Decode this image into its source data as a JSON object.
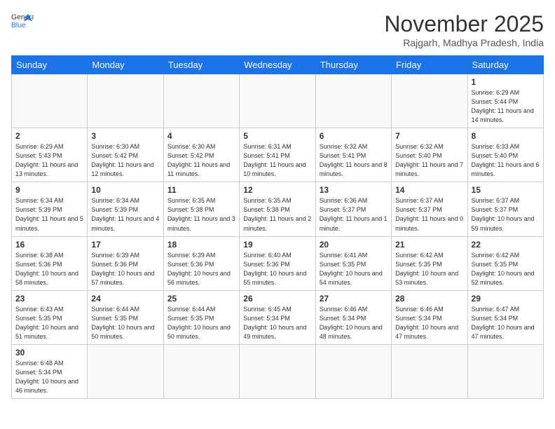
{
  "header": {
    "logo_general": "General",
    "logo_blue": "Blue",
    "month_title": "November 2025",
    "subtitle": "Rajgarh, Madhya Pradesh, India"
  },
  "weekdays": [
    "Sunday",
    "Monday",
    "Tuesday",
    "Wednesday",
    "Thursday",
    "Friday",
    "Saturday"
  ],
  "days": [
    {
      "date": "",
      "info": ""
    },
    {
      "date": "",
      "info": ""
    },
    {
      "date": "",
      "info": ""
    },
    {
      "date": "",
      "info": ""
    },
    {
      "date": "",
      "info": ""
    },
    {
      "date": "",
      "info": ""
    },
    {
      "date": "1",
      "info": "Sunrise: 6:29 AM\nSunset: 5:44 PM\nDaylight: 11 hours\nand 14 minutes."
    },
    {
      "date": "2",
      "info": "Sunrise: 6:29 AM\nSunset: 5:43 PM\nDaylight: 11 hours\nand 13 minutes."
    },
    {
      "date": "3",
      "info": "Sunrise: 6:30 AM\nSunset: 5:42 PM\nDaylight: 11 hours\nand 12 minutes."
    },
    {
      "date": "4",
      "info": "Sunrise: 6:30 AM\nSunset: 5:42 PM\nDaylight: 11 hours\nand 11 minutes."
    },
    {
      "date": "5",
      "info": "Sunrise: 6:31 AM\nSunset: 5:41 PM\nDaylight: 11 hours\nand 10 minutes."
    },
    {
      "date": "6",
      "info": "Sunrise: 6:32 AM\nSunset: 5:41 PM\nDaylight: 11 hours\nand 8 minutes."
    },
    {
      "date": "7",
      "info": "Sunrise: 6:32 AM\nSunset: 5:40 PM\nDaylight: 11 hours\nand 7 minutes."
    },
    {
      "date": "8",
      "info": "Sunrise: 6:33 AM\nSunset: 5:40 PM\nDaylight: 11 hours\nand 6 minutes."
    },
    {
      "date": "9",
      "info": "Sunrise: 6:34 AM\nSunset: 5:39 PM\nDaylight: 11 hours\nand 5 minutes."
    },
    {
      "date": "10",
      "info": "Sunrise: 6:34 AM\nSunset: 5:39 PM\nDaylight: 11 hours\nand 4 minutes."
    },
    {
      "date": "11",
      "info": "Sunrise: 6:35 AM\nSunset: 5:38 PM\nDaylight: 11 hours\nand 3 minutes."
    },
    {
      "date": "12",
      "info": "Sunrise: 6:35 AM\nSunset: 5:38 PM\nDaylight: 11 hours\nand 2 minutes."
    },
    {
      "date": "13",
      "info": "Sunrise: 6:36 AM\nSunset: 5:37 PM\nDaylight: 11 hours\nand 1 minute."
    },
    {
      "date": "14",
      "info": "Sunrise: 6:37 AM\nSunset: 5:37 PM\nDaylight: 11 hours\nand 0 minutes."
    },
    {
      "date": "15",
      "info": "Sunrise: 6:37 AM\nSunset: 5:37 PM\nDaylight: 10 hours\nand 59 minutes."
    },
    {
      "date": "16",
      "info": "Sunrise: 6:38 AM\nSunset: 5:36 PM\nDaylight: 10 hours\nand 58 minutes."
    },
    {
      "date": "17",
      "info": "Sunrise: 6:39 AM\nSunset: 5:36 PM\nDaylight: 10 hours\nand 57 minutes."
    },
    {
      "date": "18",
      "info": "Sunrise: 6:39 AM\nSunset: 5:36 PM\nDaylight: 10 hours\nand 56 minutes."
    },
    {
      "date": "19",
      "info": "Sunrise: 6:40 AM\nSunset: 5:36 PM\nDaylight: 10 hours\nand 55 minutes."
    },
    {
      "date": "20",
      "info": "Sunrise: 6:41 AM\nSunset: 5:35 PM\nDaylight: 10 hours\nand 54 minutes."
    },
    {
      "date": "21",
      "info": "Sunrise: 6:42 AM\nSunset: 5:35 PM\nDaylight: 10 hours\nand 53 minutes."
    },
    {
      "date": "22",
      "info": "Sunrise: 6:42 AM\nSunset: 5:35 PM\nDaylight: 10 hours\nand 52 minutes."
    },
    {
      "date": "23",
      "info": "Sunrise: 6:43 AM\nSunset: 5:35 PM\nDaylight: 10 hours\nand 51 minutes."
    },
    {
      "date": "24",
      "info": "Sunrise: 6:44 AM\nSunset: 5:35 PM\nDaylight: 10 hours\nand 50 minutes."
    },
    {
      "date": "25",
      "info": "Sunrise: 6:44 AM\nSunset: 5:35 PM\nDaylight: 10 hours\nand 50 minutes."
    },
    {
      "date": "26",
      "info": "Sunrise: 6:45 AM\nSunset: 5:34 PM\nDaylight: 10 hours\nand 49 minutes."
    },
    {
      "date": "27",
      "info": "Sunrise: 6:46 AM\nSunset: 5:34 PM\nDaylight: 10 hours\nand 48 minutes."
    },
    {
      "date": "28",
      "info": "Sunrise: 6:46 AM\nSunset: 5:34 PM\nDaylight: 10 hours\nand 47 minutes."
    },
    {
      "date": "29",
      "info": "Sunrise: 6:47 AM\nSunset: 5:34 PM\nDaylight: 10 hours\nand 47 minutes."
    },
    {
      "date": "30",
      "info": "Sunrise: 6:48 AM\nSunset: 5:34 PM\nDaylight: 10 hours\nand 46 minutes."
    }
  ]
}
